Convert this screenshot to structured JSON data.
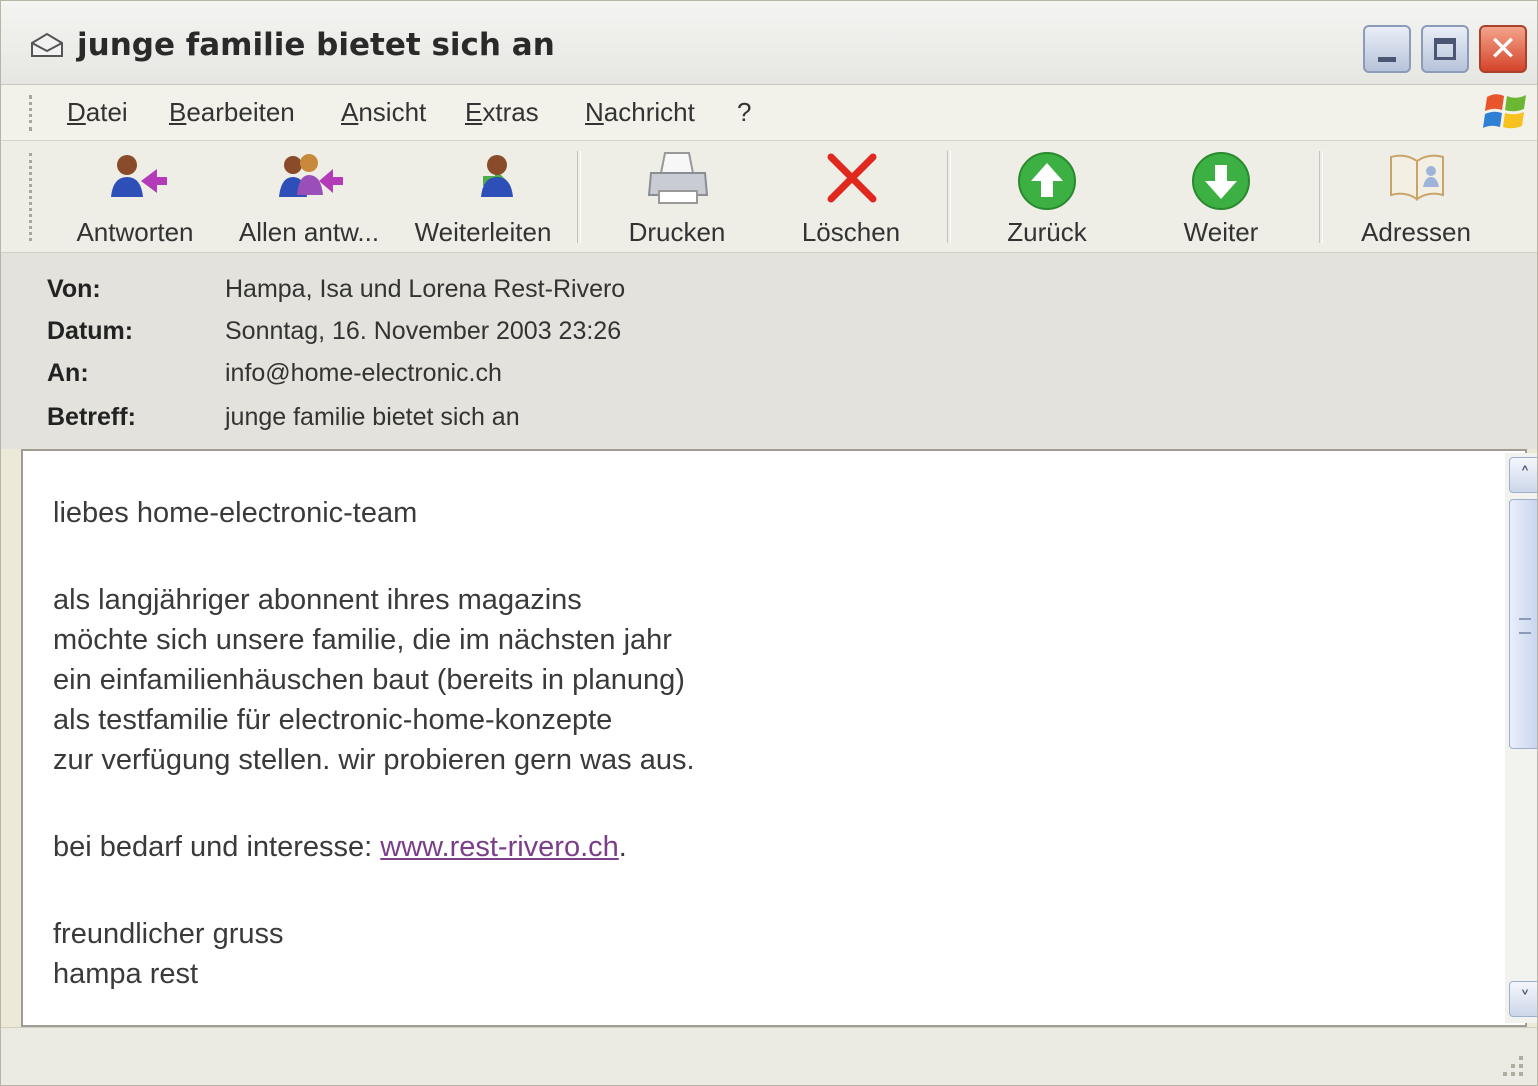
{
  "window": {
    "title": "junge familie bietet sich an",
    "controls": {
      "minimize": "minimize",
      "maximize": "maximize",
      "close": "✕"
    }
  },
  "menu": {
    "items": [
      "Datei",
      "Bearbeiten",
      "Ansicht",
      "Extras",
      "Nachricht",
      "?"
    ]
  },
  "toolbar": {
    "buttons": [
      {
        "label": "Antworten",
        "icon": "reply-icon"
      },
      {
        "label": "Allen antw...",
        "icon": "reply-all-icon"
      },
      {
        "label": "Weiterleiten",
        "icon": "forward-icon"
      },
      {
        "label": "Drucken",
        "icon": "printer-icon"
      },
      {
        "label": "Löschen",
        "icon": "delete-x-icon"
      },
      {
        "label": "Zurück",
        "icon": "arrow-up-green-icon"
      },
      {
        "label": "Weiter",
        "icon": "arrow-down-green-icon"
      },
      {
        "label": "Adressen",
        "icon": "address-book-icon"
      }
    ]
  },
  "header": {
    "from_label": "Von:",
    "from_value": "Hampa, Isa und Lorena Rest-Rivero",
    "date_label": "Datum:",
    "date_value": "Sonntag, 16. November 2003 23:26",
    "to_label": "An:",
    "to_value": "info@home-electronic.ch",
    "subject_label": "Betreff:",
    "subject_value": "junge familie bietet sich an"
  },
  "message": {
    "greeting": "liebes home-electronic-team",
    "lines": [
      "als langjähriger abonnent ihres magazins",
      "möchte sich unsere familie, die im nächsten jahr",
      "ein einfamilienhäuschen baut (bereits in planung)",
      "als testfamilie für electronic-home-konzepte",
      "zur verfügung stellen. wir probieren gern was aus."
    ],
    "link_prefix": "bei bedarf und interesse: ",
    "link_text": "www.rest-rivero.ch",
    "link_suffix": ".",
    "closing": "freundlicher gruss",
    "signature": "hampa rest"
  },
  "colors": {
    "link": "#7b3f8a",
    "close_button": "#d4432a",
    "nav_green": "#3cb043"
  }
}
